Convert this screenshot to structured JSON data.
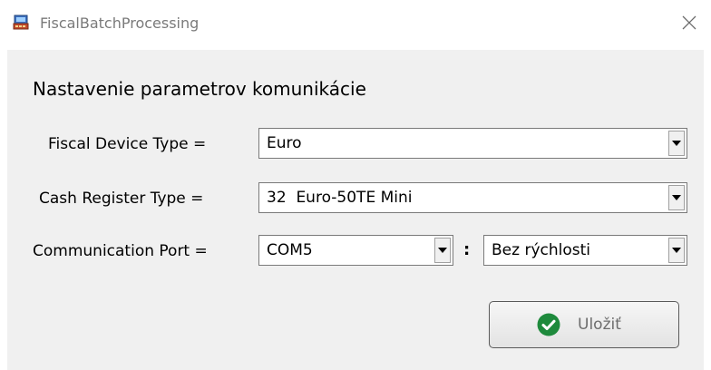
{
  "window": {
    "title": "FiscalBatchProcessing",
    "close_glyph": "✕",
    "icon": "cash-register-icon"
  },
  "form": {
    "heading": "Nastavenie parametrov komunikácie",
    "fiscal_device_type": {
      "label": "Fiscal Device Type =",
      "value": "Euro"
    },
    "cash_register_type": {
      "label": "Cash Register Type =",
      "value": "32  Euro-50TE Mini"
    },
    "communication_port": {
      "label": "Communication Port =",
      "value": "COM5",
      "separator": ":",
      "speed_value": "Bez rýchlosti"
    },
    "save_button": {
      "label": "Uložiť",
      "icon": "check-circle-icon",
      "icon_color": "#1e8a3c"
    }
  },
  "colors": {
    "client_background": "#f0f0f0",
    "title_text": "#7a7a7a"
  }
}
